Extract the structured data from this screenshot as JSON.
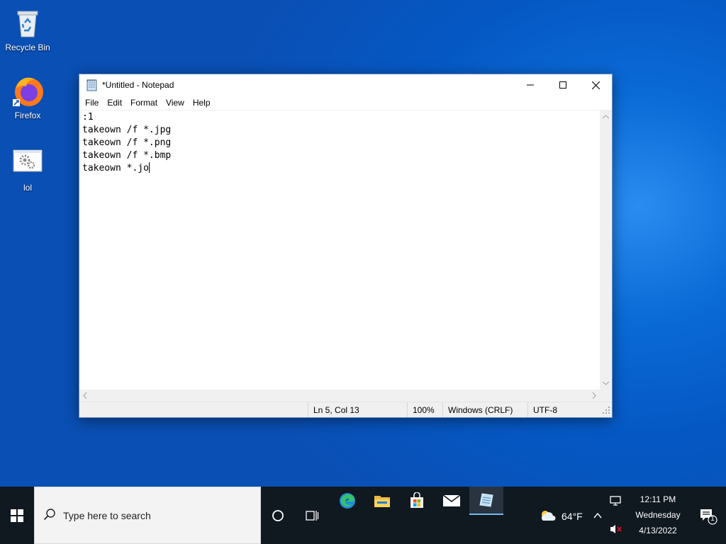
{
  "desktop": {
    "icons": [
      {
        "label": "Recycle Bin"
      },
      {
        "label": "Firefox"
      },
      {
        "label": "lol"
      }
    ]
  },
  "notepad": {
    "title": "*Untitled - Notepad",
    "menu": [
      "File",
      "Edit",
      "Format",
      "View",
      "Help"
    ],
    "lines": [
      ":1",
      "takeown /f *.jpg",
      "takeown /f *.png",
      "takeown /f *.bmp",
      "takeown *.jo"
    ],
    "status": {
      "position": "Ln 5, Col 13",
      "zoom": "100%",
      "line_ending": "Windows (CRLF)",
      "encoding": "UTF-8"
    }
  },
  "taskbar": {
    "search_placeholder": "Type here to search",
    "weather": "64°F",
    "time": "12:11 PM",
    "day": "Wednesday",
    "date": "4/13/2022",
    "notification_count": "1"
  },
  "colors": {
    "taskbar_bg": "#101820",
    "accent": "#0078d7"
  }
}
